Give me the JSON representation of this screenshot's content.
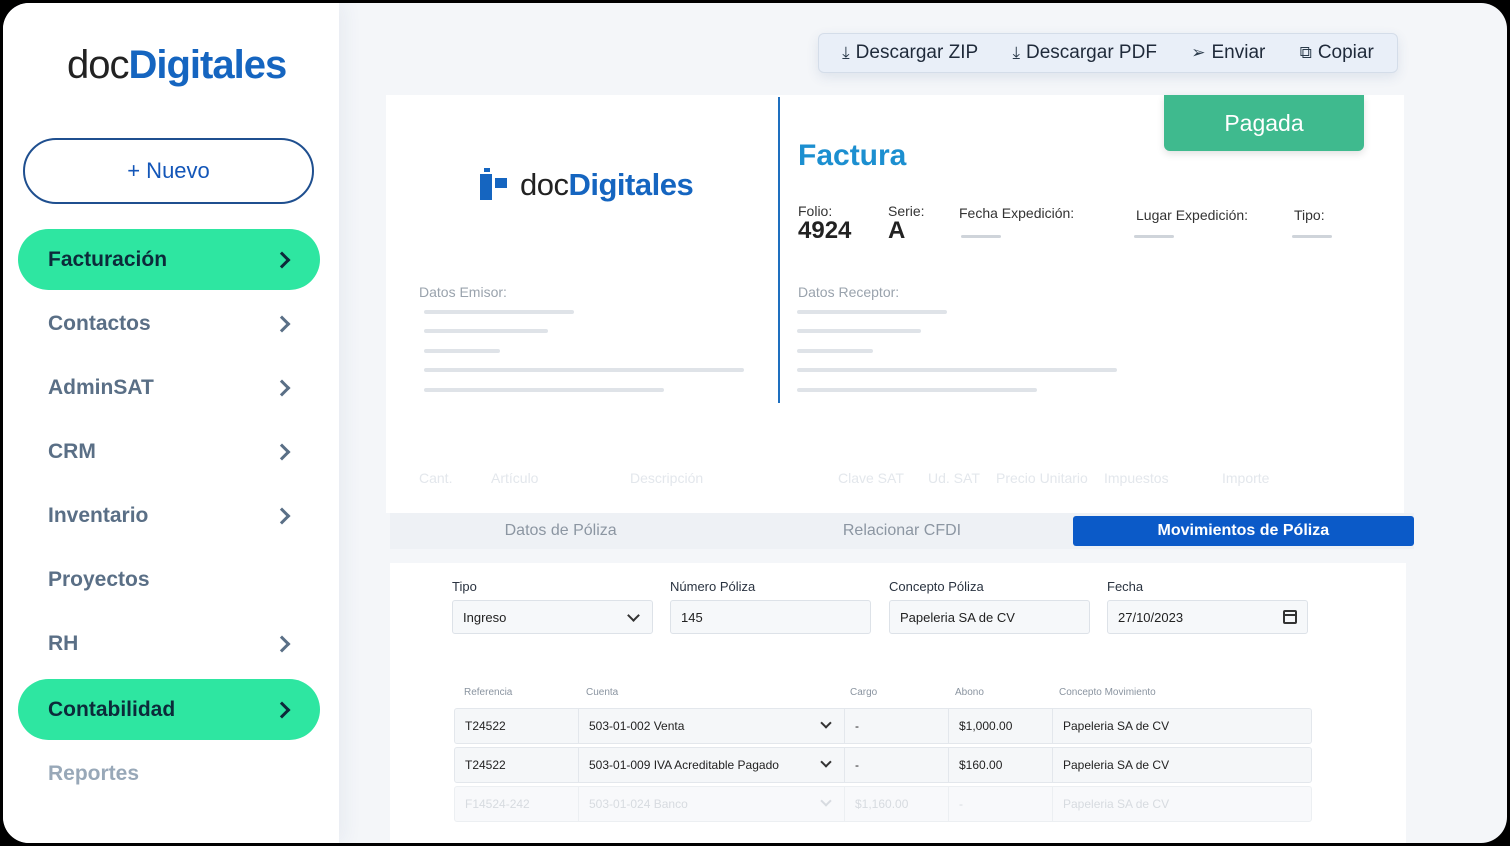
{
  "sidebar": {
    "logo": {
      "part1": "doc",
      "part2": "Digitales"
    },
    "new_button": "+ Nuevo",
    "items": [
      {
        "label": "Facturación",
        "active": true,
        "chevron": true
      },
      {
        "label": "Contactos",
        "active": false,
        "chevron": true
      },
      {
        "label": "AdminSAT",
        "active": false,
        "chevron": true
      },
      {
        "label": "CRM",
        "active": false,
        "chevron": true
      },
      {
        "label": "Inventario",
        "active": false,
        "chevron": true
      },
      {
        "label": "Proyectos",
        "active": false,
        "chevron": false
      },
      {
        "label": "RH",
        "active": false,
        "chevron": true
      },
      {
        "label": "Contabilidad",
        "active": true,
        "chevron": true
      },
      {
        "label": "Reportes",
        "active": false,
        "chevron": false
      }
    ]
  },
  "toolbar": {
    "zip": {
      "icon": "download-icon",
      "label": "Descargar ZIP"
    },
    "pdf": {
      "icon": "download-icon",
      "label": "Descargar PDF"
    },
    "send": {
      "icon": "send-icon",
      "label": "Enviar"
    },
    "copy": {
      "icon": "copy-icon",
      "label": "Copiar"
    }
  },
  "invoice": {
    "logo": {
      "part1": "doc",
      "part2": "Digitales"
    },
    "status": "Pagada",
    "title": "Factura",
    "folio_label": "Folio:",
    "folio": "4924",
    "serie_label": "Serie:",
    "serie": "A",
    "fecha_label": "Fecha Expedición:",
    "lugar_label": "Lugar Expedición:",
    "tipo_label": "Tipo:",
    "emisor_label": "Datos Emisor:",
    "receptor_label": "Datos Receptor:",
    "table_headers": [
      "Cant.",
      "Artículo",
      "Descripción",
      "Clave SAT",
      "Ud. SAT",
      "Precio Unitario",
      "Impuestos",
      "Importe"
    ]
  },
  "tabs": [
    {
      "label": "Datos de Póliza",
      "active": false
    },
    {
      "label": "Relacionar CFDI",
      "active": false
    },
    {
      "label": "Movimientos de Póliza",
      "active": true
    }
  ],
  "form": {
    "tipo": {
      "label": "Tipo",
      "value": "Ingreso"
    },
    "numero": {
      "label": "Número Póliza",
      "value": "145"
    },
    "concepto": {
      "label": "Concepto Póliza",
      "value": "Papeleria SA de CV"
    },
    "fecha": {
      "label": "Fecha",
      "value": "27/10/2023"
    }
  },
  "movements": {
    "headers": [
      "Referencia",
      "Cuenta",
      "Cargo",
      "Abono",
      "Concepto Movimiento"
    ],
    "rows": [
      {
        "ref": "T24522",
        "cuenta": "503-01-002 Venta",
        "cargo": "-",
        "abono": "$1,000.00",
        "concepto": "Papeleria SA de CV"
      },
      {
        "ref": "T24522",
        "cuenta": "503-01-009 IVA Acreditable Pagado",
        "cargo": "-",
        "abono": "$160.00",
        "concepto": "Papeleria SA de CV"
      },
      {
        "ref": "F14524-242",
        "cuenta": "503-01-024 Banco",
        "cargo": "$1,160.00",
        "abono": "-",
        "concepto": "Papeleria SA de CV"
      }
    ]
  },
  "colors": {
    "accent": "#2ee6a1",
    "brand": "#1565c0",
    "primary_tab": "#0b5ac8",
    "paid": "#3fba8e"
  }
}
